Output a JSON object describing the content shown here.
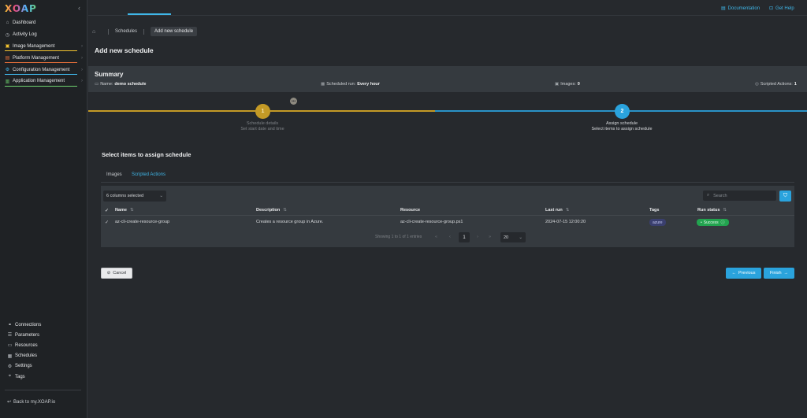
{
  "app": {
    "logo": "XOAP"
  },
  "sidebar": {
    "items": [
      {
        "label": "Dashboard",
        "icon": "home-icon"
      },
      {
        "label": "Activity Log",
        "icon": "clock-icon"
      },
      {
        "label": "Image Management",
        "icon": "image-icon",
        "accent": "#f4c430"
      },
      {
        "label": "Platform Management",
        "icon": "platform-icon",
        "accent": "#e8703a"
      },
      {
        "label": "Configuration Management",
        "icon": "config-icon",
        "accent": "#3fb6e8"
      },
      {
        "label": "Application Management",
        "icon": "app-icon",
        "accent": "#6fd36f"
      }
    ],
    "bottom_items": [
      {
        "label": "Connections",
        "icon": "link-icon"
      },
      {
        "label": "Parameters",
        "icon": "list-icon"
      },
      {
        "label": "Resources",
        "icon": "box-icon"
      },
      {
        "label": "Schedules",
        "icon": "calendar-icon"
      },
      {
        "label": "Settings",
        "icon": "gear-icon"
      },
      {
        "label": "Tags",
        "icon": "tag-icon"
      }
    ],
    "back_link": "Back to my.XOAP.io"
  },
  "topbar": {
    "documentation": "Documentation",
    "help": "Get Help"
  },
  "breadcrumb": {
    "schedules": "Schedules",
    "current": "Add new schedule"
  },
  "page": {
    "title": "Add new schedule"
  },
  "summary": {
    "title": "Summary",
    "name_label": "Name:",
    "name_value": "demo schedule",
    "run_label": "Scheduled run:",
    "run_value": "Every hour",
    "images_label": "Images:",
    "images_value": "0",
    "actions_label": "Scripted Actions:",
    "actions_value": "1"
  },
  "stepper": {
    "step1": {
      "number": "1",
      "title": "Schedule details",
      "subtitle": "Set start date and time"
    },
    "step2": {
      "number": "2",
      "title": "Assign schedule",
      "subtitle": "Select items to assign schedule"
    }
  },
  "section": {
    "title": "Select items to assign schedule"
  },
  "tabs": [
    {
      "label": "Images"
    },
    {
      "label": "Scripted Actions"
    }
  ],
  "table": {
    "columns_selected": "6 columns selected",
    "search_placeholder": "Search",
    "headers": {
      "name": "Name",
      "description": "Description",
      "resource": "Resource",
      "last_run": "Last run",
      "tags": "Tags",
      "run_status": "Run status"
    },
    "rows": [
      {
        "name": "az-cli-create-resource-group",
        "description": "Creates a resource group in Azure.",
        "resource": "az-cli-create-resource-group.ps1",
        "last_run": "2024-07-15 12:00:20",
        "tag": "azure",
        "status": "Success"
      }
    ],
    "pagination": {
      "info": "Showing 1 to 1 of 1 entries",
      "current_page": "1",
      "page_size": "20"
    }
  },
  "buttons": {
    "cancel": "Cancel",
    "previous": "Previous",
    "finish": "Finish"
  },
  "colors": {
    "accent": "#2aa3dd",
    "step1": "#c49a26",
    "success": "#22a34f"
  }
}
